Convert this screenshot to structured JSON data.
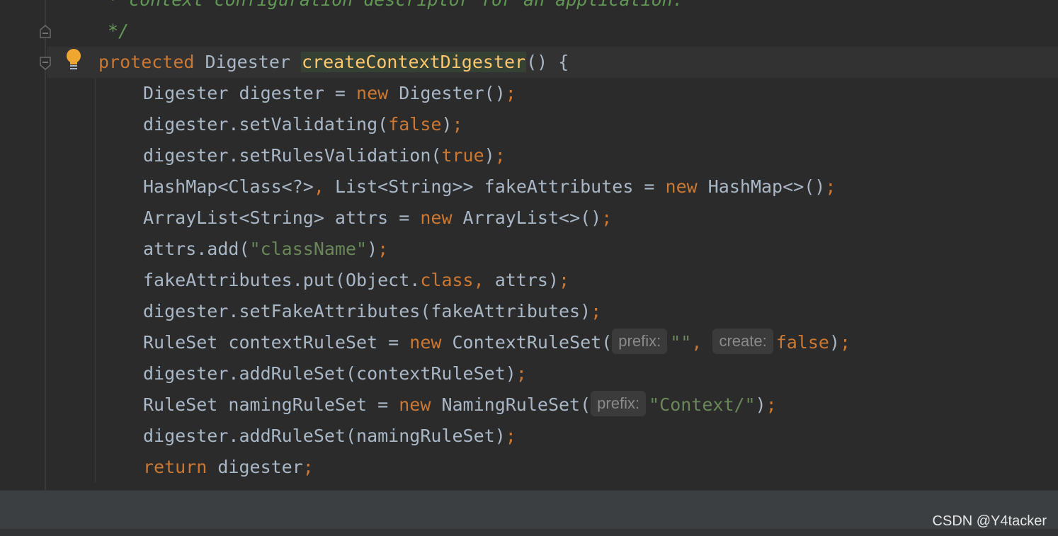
{
  "editor": {
    "comment_top": "* context configuration descriptor for an application.",
    "comment_end": "*/",
    "method": {
      "modifier": "protected",
      "return_type": "Digester",
      "name": "createContextDigester",
      "params": "() {"
    },
    "lines": {
      "l1": {
        "a": "Digester digester = ",
        "kw": "new",
        "b": " Digester()",
        "semi": ";"
      },
      "l2": {
        "a": "digester.setValidating(",
        "lit": "false",
        "b": ")",
        "semi": ";"
      },
      "l3": {
        "a": "digester.setRulesValidation(",
        "lit": "true",
        "b": ")",
        "semi": ";"
      },
      "l4": {
        "a": "HashMap<Class<?>",
        "comma": ",",
        "b": " List<String>> fakeAttributes = ",
        "kw": "new",
        "c": " HashMap<>()",
        "semi": ";"
      },
      "l5": {
        "a": "ArrayList<String> attrs = ",
        "kw": "new",
        "b": " ArrayList<>()",
        "semi": ";"
      },
      "l6": {
        "a": "attrs.add(",
        "str": "\"className\"",
        "b": ")",
        "semi": ";"
      },
      "l7": {
        "a": "fakeAttributes.put(Object.",
        "kw": "class,",
        "b": " attrs)",
        "semi": ";"
      },
      "l8": {
        "a": "digester.setFakeAttributes(fakeAttributes)",
        "semi": ";"
      },
      "l9": {
        "a": "RuleSet contextRuleSet = ",
        "kw": "new",
        "b": " ContextRuleSet(",
        "hint1": "prefix:",
        "str": "\"\"",
        "comma": ",",
        "hint2": "create:",
        "lit": "false",
        "c": ")",
        "semi": ";"
      },
      "l10": {
        "a": "digester.addRuleSet(contextRuleSet)",
        "semi": ";"
      },
      "l11": {
        "a": "RuleSet namingRuleSet = ",
        "kw": "new",
        "b": " NamingRuleSet(",
        "hint": "prefix:",
        "str": "\"Context/\"",
        "c": ")",
        "semi": ";"
      },
      "l12": {
        "a": "digester.addRuleSet(namingRuleSet)",
        "semi": ";"
      },
      "l13": {
        "kw": "return",
        "a": " digester",
        "semi": ";"
      }
    }
  },
  "icons": {
    "bulb": "lightbulb-icon",
    "fold": "fold-marker-icon"
  },
  "colors": {
    "background": "#2b2b2b",
    "keyword": "#cc7832",
    "string": "#6a8759",
    "comment": "#629755",
    "method_decl": "#ffc66d",
    "text": "#a9b7c6"
  },
  "watermark": "CSDN @Y4tacker"
}
